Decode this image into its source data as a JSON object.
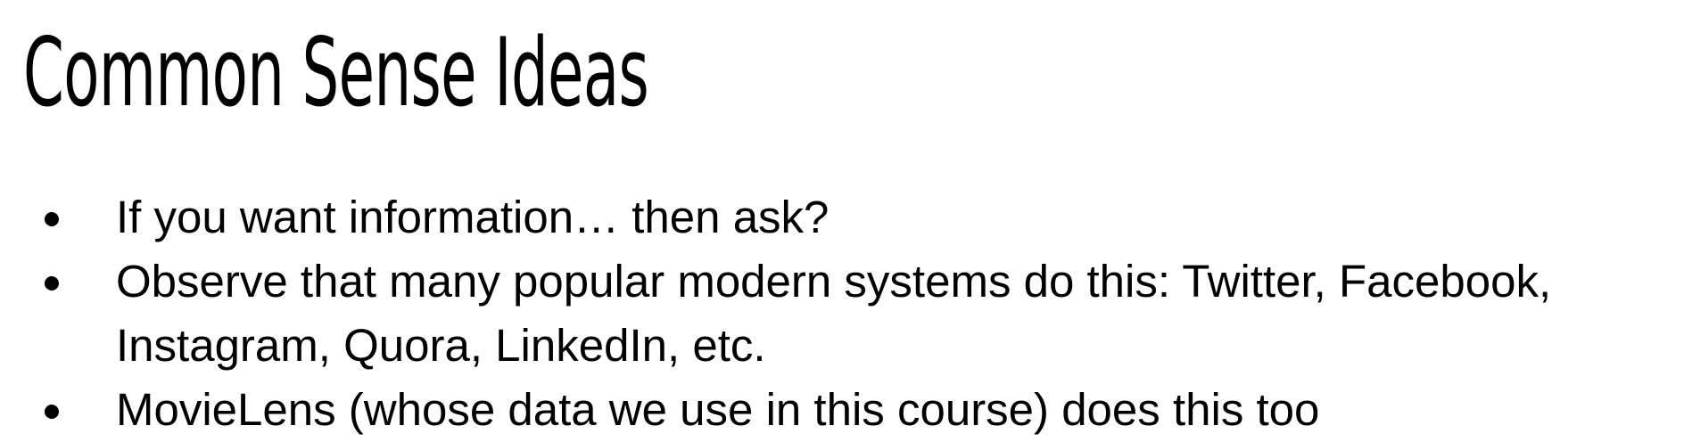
{
  "title": "Common Sense Ideas",
  "bullets": [
    "If you want information… then ask?",
    "Observe that many popular modern systems do this: Twitter, Facebook, Instagram, Quora, LinkedIn, etc.",
    "MovieLens (whose data we use in this course) does this too"
  ]
}
